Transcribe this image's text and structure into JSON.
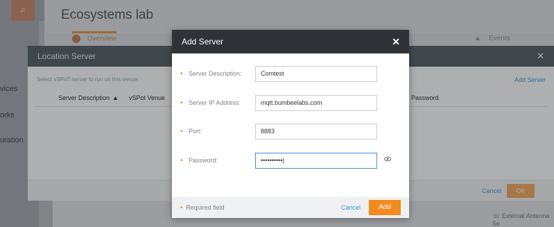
{
  "app": {
    "logo_glyph": "⌕",
    "title": "Ecosystems lab",
    "sidebar_labels": [
      "vices",
      "orks",
      "uration"
    ],
    "tabs": [
      {
        "label": "Overview",
        "active": true
      },
      {
        "label": "Events",
        "active": false
      }
    ],
    "bottom_items": [
      "External Antenna Se"
    ]
  },
  "location_server": {
    "title": "Location Server",
    "hint": "Select vSPoT server to run on this venue:",
    "add_server_label": "Add Server",
    "columns": [
      "Server Description",
      "vSPot Venue",
      "Password"
    ],
    "sort_glyph": "▲",
    "cancel_label": "Cancel",
    "ok_label": "OK"
  },
  "modal": {
    "title": "Add Server",
    "fields": [
      {
        "label": "Server Description:",
        "value": "Comtest"
      },
      {
        "label": "Server IP Address:",
        "value": "mqtt.bumbeelabs.com"
      },
      {
        "label": "Port:",
        "value": "8883"
      },
      {
        "label": "Password:",
        "value": "••••••••••|"
      }
    ],
    "required_note": "Required field",
    "cancel_label": "Cancel",
    "add_label": "Add"
  },
  "colors": {
    "accent": "#f28a1e",
    "link": "#3b95d6",
    "modal_header": "#2f3337",
    "panel_header": "#50575e"
  }
}
